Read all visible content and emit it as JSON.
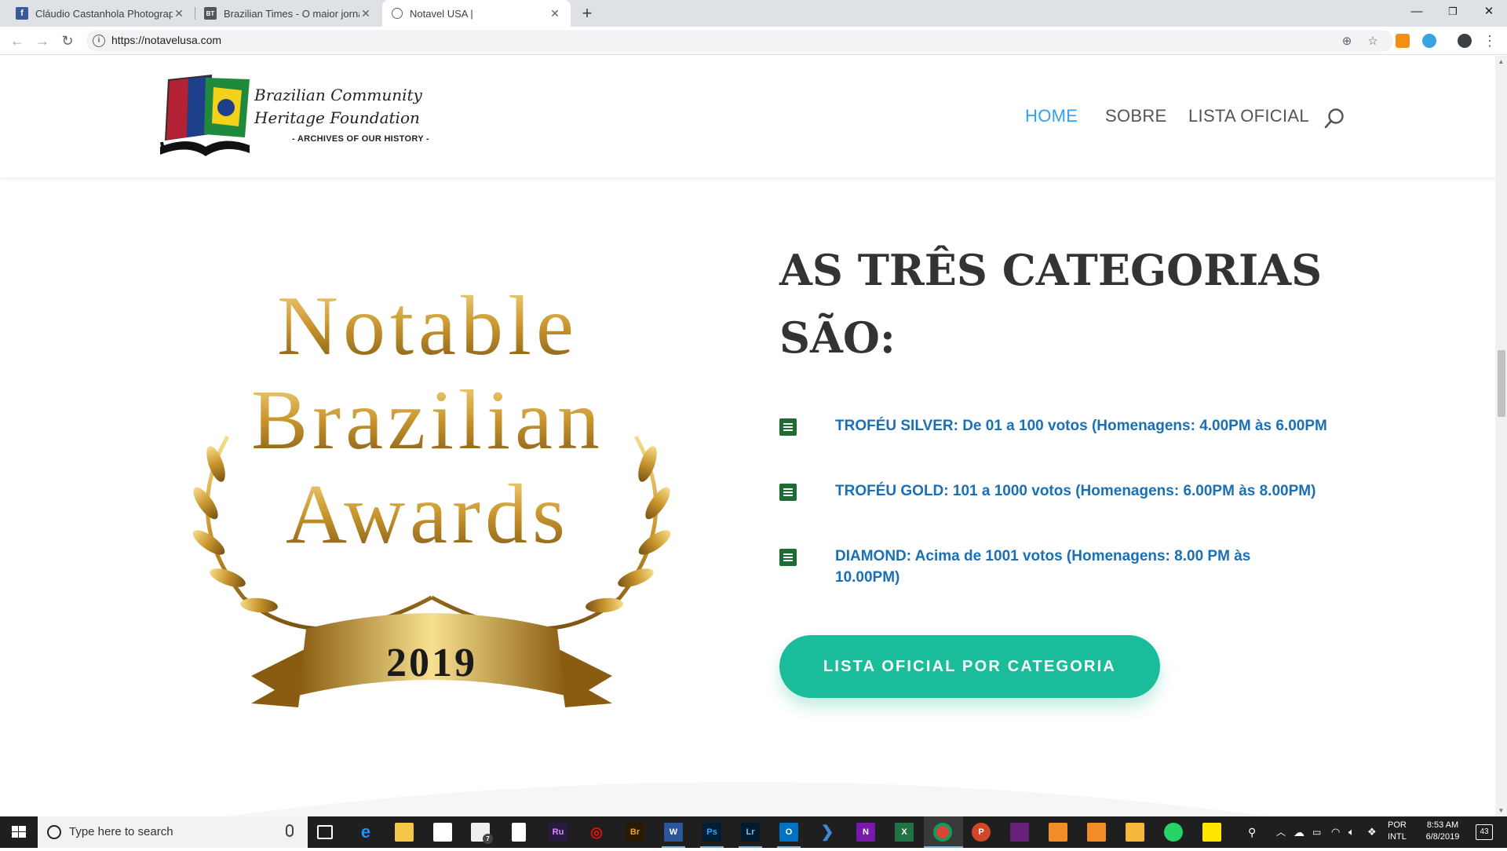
{
  "browser": {
    "tabs": [
      {
        "title": "Cláudio Castanhola Photography",
        "favicon": "facebook-icon"
      },
      {
        "title": "Brazilian Times - O maior jornal b",
        "favicon": "brazilian-times-icon"
      },
      {
        "title": "Notavel USA |",
        "favicon": "globe-icon"
      }
    ],
    "url": "https://notavelusa.com"
  },
  "site": {
    "logo": {
      "line1": "Brazilian Community",
      "line2": "Heritage Foundation",
      "line3": "- ARCHIVES OF OUR HISTORY -"
    },
    "nav": [
      "HOME",
      "SOBRE",
      "LISTA OFICIAL"
    ],
    "active_nav": "HOME"
  },
  "award_image": {
    "line1": "Notable",
    "line2": "Brazilian",
    "line3": "Awards",
    "year": "2019"
  },
  "section": {
    "title": "AS TRÊS CATEGORIAS SÃO:",
    "categories": [
      "TROFÉU SILVER: De 01 a 100 votos (Homenagens: 4.00PM às 6.00PM",
      "TROFÉU GOLD: 101 a 1000 votos (Homenagens: 6.00PM às 8.00PM)",
      "DIAMOND: Acima de 1001 votos (Homenagens: 8.00 PM às 10.00PM)"
    ],
    "cta": "LISTA OFICIAL POR CATEGORIA"
  },
  "taskbar": {
    "search_placeholder": "Type here to search",
    "lang1": "POR",
    "lang2": "INTL",
    "time": "8:53 AM",
    "date": "6/8/2019",
    "notifications": "43",
    "mail_badge": "7"
  },
  "colors": {
    "accent_nav": "#2ea3f2",
    "category_text": "#1a6fb5",
    "cta": "#1bbc9b",
    "icon_green": "#1e6b33"
  }
}
